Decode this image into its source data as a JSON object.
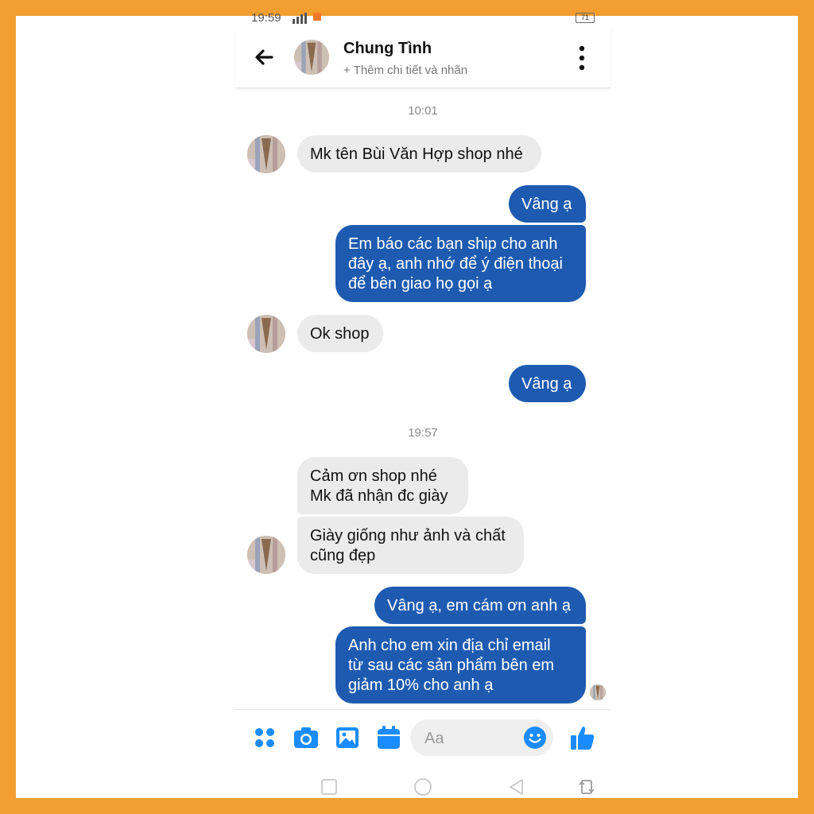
{
  "status_bar": {
    "time": "19:59",
    "battery": "71"
  },
  "header": {
    "contact_name": "Chung Tình",
    "subtitle": "+ Thêm chi tiết và nhãn"
  },
  "conversation": {
    "timestamp_1": "10:01",
    "timestamp_2": "19:57",
    "messages": [
      {
        "dir": "in",
        "text": "Mk tên Bùi Văn Hợp shop nhé"
      },
      {
        "dir": "out",
        "text": "Vâng ạ"
      },
      {
        "dir": "out",
        "lines": [
          "Em báo các bạn ship cho anh",
          "đây ạ, anh nhớ để ý điện thoại",
          "để bên giao họ gọi ạ"
        ]
      },
      {
        "dir": "in",
        "text": "Ok shop"
      },
      {
        "dir": "out",
        "text": "Vâng ạ"
      },
      {
        "dir": "in",
        "lines": [
          "Cảm ơn shop nhé",
          "Mk đã nhận đc giày"
        ]
      },
      {
        "dir": "in",
        "lines": [
          "Giày giống như ảnh và chất",
          "cũng đẹp"
        ]
      },
      {
        "dir": "out",
        "text": "Vâng ạ, em cám ơn anh ạ"
      },
      {
        "dir": "out",
        "lines": [
          "Anh cho em xin địa chỉ email",
          "từ sau các sản phẩm bên em",
          "giảm 10% cho anh ạ"
        ]
      }
    ]
  },
  "composer": {
    "placeholder": "Aa",
    "icons": [
      "apps-icon",
      "camera-icon",
      "gallery-icon",
      "calendar-icon",
      "emoji-icon",
      "thumbs-up-icon"
    ]
  },
  "colors": {
    "accent": "#1e5bb0",
    "icon_blue": "#1a8cff",
    "frame": "#f29e30",
    "incoming_bubble": "#ebebeb"
  }
}
